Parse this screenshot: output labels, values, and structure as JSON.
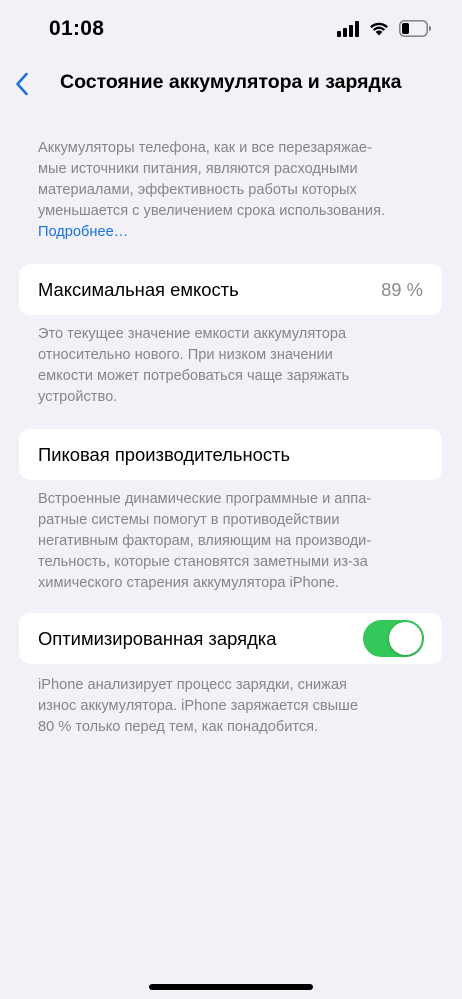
{
  "status_bar": {
    "time": "01:08",
    "icons": [
      "cellular-signal-icon",
      "wifi-icon",
      "battery-icon"
    ]
  },
  "nav": {
    "back_icon": "chevron-left-icon",
    "title": "Состояние аккумулятора и зарядка"
  },
  "intro": {
    "lines": [
      "Аккумуляторы телефона, как и все перезаряжае-",
      "мые источники питания, являются расходными",
      "материалами, эффективность работы которых",
      "уменьшается с увеличением срока использования."
    ],
    "link": "Подробнее…"
  },
  "max_capacity": {
    "label": "Максимальная емкость",
    "value": "89 %",
    "footer_lines": [
      "Это текущее значение емкости аккумулятора",
      "относительно нового. При низком значении",
      "емкости может потребоваться чаще заряжать",
      "устройство."
    ]
  },
  "peak_performance": {
    "label": "Пиковая производительность",
    "footer_lines": [
      "Встроенные динамические программные и аппа-",
      "ратные системы помогут в противодействии",
      "негативным факторам, влияющим на производи-",
      "тельность, которые становятся заметными из-за",
      "химического старения аккумулятора iPhone."
    ]
  },
  "optimized_charging": {
    "label": "Оптимизированная зарядка",
    "enabled": true,
    "footer_lines": [
      "iPhone анализирует процесс зарядки, снижая",
      "износ аккумулятора. iPhone заряжается свыше",
      "80 % только перед тем, как понадобится."
    ]
  },
  "colors": {
    "background": "#f2f1f7",
    "accent": "#1a73d9",
    "toggle_on": "#34c759",
    "secondary_text": "#85858b"
  }
}
